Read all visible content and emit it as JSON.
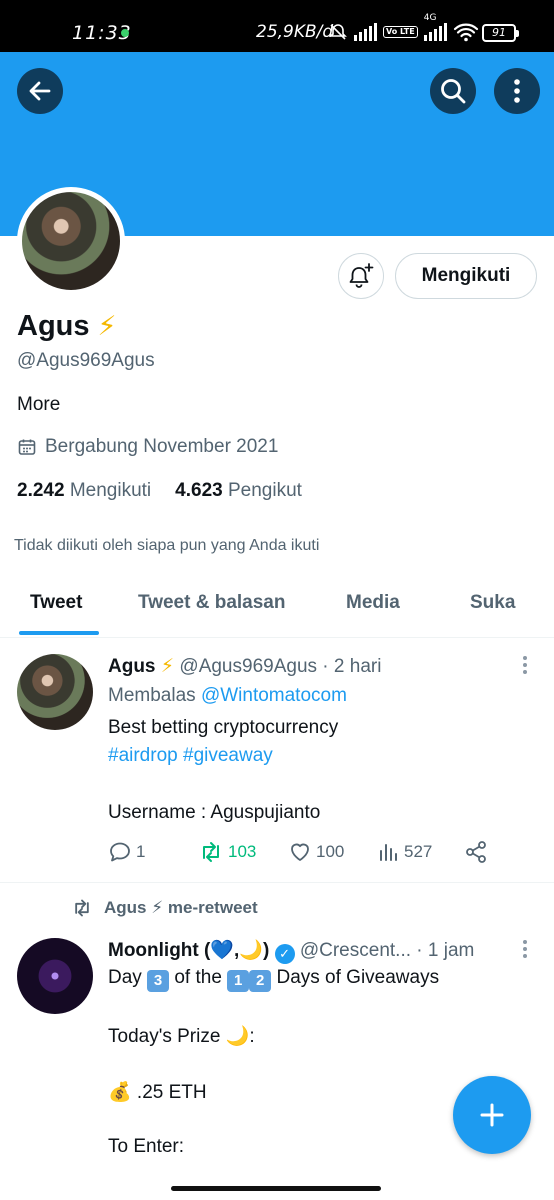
{
  "status_bar": {
    "time": "11:33",
    "speed": "25,9KB/d",
    "lte_label": "Vo LTE",
    "network": "4G",
    "battery": "91"
  },
  "profile": {
    "name": "Agus",
    "name_emoji": "⚡",
    "handle": "@Agus969Agus",
    "bio": "More",
    "joined": "Bergabung November 2021",
    "following_count": "2.242",
    "following_label": "Mengikuti",
    "followers_count": "4.623",
    "followers_label": "Pengikut",
    "not_followed": "Tidak diikuti oleh siapa pun yang Anda ikuti",
    "follow_button": "Mengikuti"
  },
  "tabs": [
    {
      "label": "Tweet",
      "active": true
    },
    {
      "label": "Tweet & balasan",
      "active": false
    },
    {
      "label": "Media",
      "active": false
    },
    {
      "label": "Suka",
      "active": false
    }
  ],
  "tweet1": {
    "name": "Agus",
    "name_emoji": "⚡",
    "handle": "@Agus969Agus",
    "time": "· 2 hari",
    "reply_prefix": "Membalas",
    "reply_to": "@Wintomatocom",
    "line1": "Best betting cryptocurrency",
    "hashtag1": "#airdrop",
    "hashtag2": "#giveaway",
    "line3": "Username : Aguspujianto",
    "replies": "1",
    "retweets": "103",
    "likes": "100",
    "views": "527"
  },
  "retweet_notice": "Agus ⚡ me-retweet",
  "tweet2": {
    "name": "Moonlight (💙,🌙)",
    "handle": "@Crescent...",
    "time": "· 1 jam",
    "line1_a": "Day",
    "line1_num": "3",
    "line1_b": "of the",
    "line1_num2a": "1",
    "line1_num2b": "2",
    "line1_c": "Days of Giveaways",
    "line2": "Today's Prize 🌙:",
    "line3": "💰 .25 ETH",
    "line4": "To Enter:"
  },
  "colors": {
    "brand": "#1d9bf0",
    "retweet_green": "#00ba7c",
    "dark_button": "#0f3c5c"
  }
}
